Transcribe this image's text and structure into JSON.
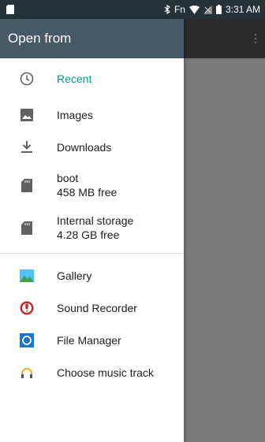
{
  "status_bar": {
    "indicators": "Fn",
    "time": "3:31 AM"
  },
  "drawer": {
    "title": "Open from",
    "roots": [
      {
        "label": "Recent",
        "icon": "clock-icon"
      },
      {
        "label": "Images",
        "icon": "image-icon"
      },
      {
        "label": "Downloads",
        "icon": "download-icon"
      },
      {
        "label": "boot",
        "sub": "458 MB free",
        "icon": "sd-card-icon"
      },
      {
        "label": "Internal storage",
        "sub": "4.28 GB free",
        "icon": "sd-card-icon"
      }
    ],
    "apps": [
      {
        "label": "Gallery",
        "icon": "gallery-icon"
      },
      {
        "label": "Sound Recorder",
        "icon": "sound-recorder-icon"
      },
      {
        "label": "File Manager",
        "icon": "file-manager-icon"
      },
      {
        "label": "Choose music track",
        "icon": "headphones-icon"
      }
    ]
  },
  "colors": {
    "status_bar": "#263238",
    "header": "#455a64",
    "accent": "#009688",
    "scrim": "#7a7a7a"
  }
}
